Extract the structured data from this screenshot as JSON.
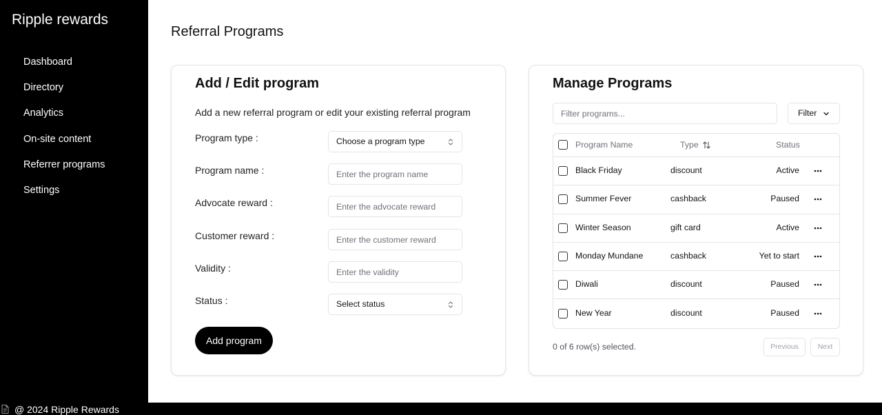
{
  "sidebar": {
    "brand": "Ripple rewards",
    "items": [
      {
        "label": "Dashboard"
      },
      {
        "label": "Directory"
      },
      {
        "label": "Analytics"
      },
      {
        "label": "On-site content"
      },
      {
        "label": "Referrer programs"
      },
      {
        "label": "Settings"
      }
    ]
  },
  "page": {
    "title": "Referral Programs"
  },
  "form": {
    "title": "Add / Edit program",
    "subtitle": "Add a new referral program or edit your existing referral program",
    "fields": [
      {
        "label": "Program type :",
        "kind": "select",
        "value": "Choose a program type"
      },
      {
        "label": "Program name :",
        "kind": "input",
        "placeholder": "Enter the program name"
      },
      {
        "label": "Advocate reward :",
        "kind": "input",
        "placeholder": "Enter the advocate reward"
      },
      {
        "label": "Customer reward :",
        "kind": "input",
        "placeholder": "Enter the customer reward"
      },
      {
        "label": "Validity :",
        "kind": "input",
        "placeholder": "Enter the validity"
      },
      {
        "label": "Status :",
        "kind": "select",
        "value": "Select status"
      }
    ],
    "submit_label": "Add program"
  },
  "manage": {
    "title": "Manage Programs",
    "filter_placeholder": "Filter programs...",
    "filter_button": "Filter",
    "columns": {
      "name": "Program Name",
      "type": "Type",
      "status": "Status"
    },
    "rows": [
      {
        "name": "Black Friday",
        "type": "discount",
        "status": "Active"
      },
      {
        "name": "Summer Fever",
        "type": "cashback",
        "status": "Paused"
      },
      {
        "name": "Winter Season",
        "type": "gift card",
        "status": "Active"
      },
      {
        "name": "Monday Mundane",
        "type": "cashback",
        "status": "Yet to start"
      },
      {
        "name": "Diwali",
        "type": "discount",
        "status": "Paused"
      },
      {
        "name": "New Year",
        "type": "discount",
        "status": "Paused"
      }
    ],
    "selection_text": "0 of 6 row(s) selected.",
    "previous_label": "Previous",
    "next_label": "Next"
  },
  "footer": {
    "text": "@ 2024 Ripple Rewards"
  },
  "icons": {
    "footer": "document-icon",
    "select_caret": "chevron-up-down-icon",
    "filter": "chevron-down-icon",
    "sort": "sort-arrows-icon",
    "row_actions": "more-horizontal-icon"
  },
  "colors": {
    "sidebar_bg": "#000000",
    "primary_button": "#000000",
    "border": "#e4e4e7",
    "muted_text": "#71717a"
  }
}
